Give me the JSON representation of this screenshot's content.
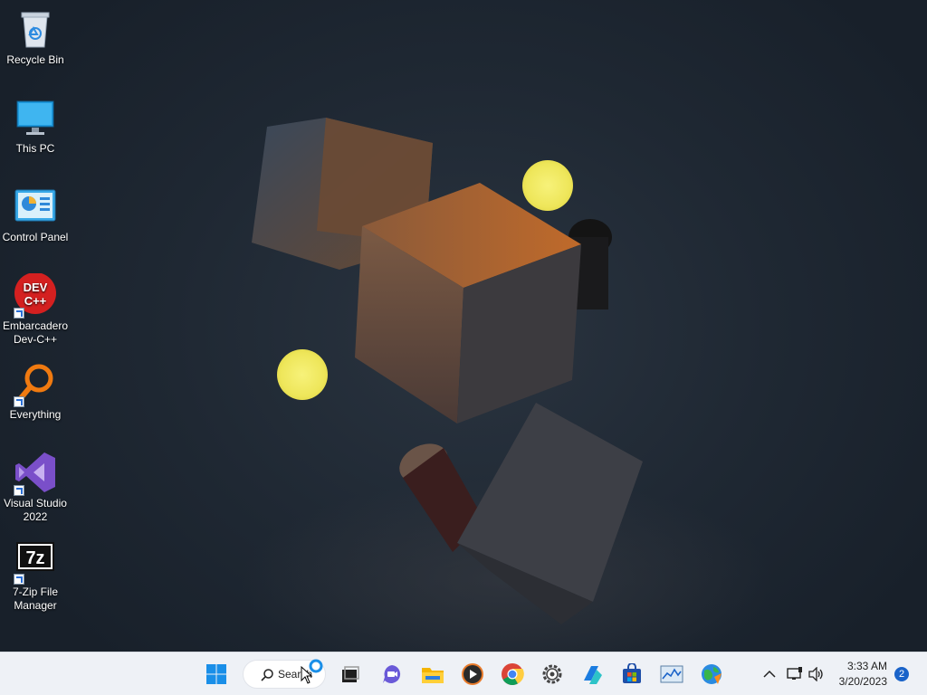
{
  "desktop_icons": [
    {
      "label": "Recycle Bin",
      "icon": "recycle-bin-icon"
    },
    {
      "label": "This PC",
      "icon": "monitor-icon"
    },
    {
      "label": "Control Panel",
      "icon": "control-panel-icon"
    },
    {
      "label": "Embarcadero Dev-C++",
      "icon": "devcpp-icon",
      "icon_text": "DEV C++"
    },
    {
      "label": "Everything",
      "icon": "everything-search-icon"
    },
    {
      "label": "Visual Studio 2022",
      "icon": "visual-studio-icon"
    },
    {
      "label": "7-Zip File Manager",
      "icon": "7zip-icon",
      "icon_text": "7z"
    }
  ],
  "taskbar": {
    "search_label": "Search",
    "apps": [
      "start-icon",
      "task-view-icon",
      "teams-chat-icon",
      "file-explorer-icon",
      "media-player-icon",
      "chrome-icon",
      "settings-icon",
      "power-automate-icon",
      "microsoft-store-icon",
      "performance-monitor-icon",
      "network-globe-icon"
    ]
  },
  "tray": {
    "time": "3:33 AM",
    "date": "3/20/2023",
    "notification_count": "2",
    "icons": [
      "chevron-up-icon",
      "network-icon",
      "volume-icon"
    ]
  },
  "colors": {
    "wallpaper": "#1f2833",
    "taskbar": "#eef1f6",
    "accent": "#1a63c9",
    "light_orb": "#f3ee6a"
  }
}
